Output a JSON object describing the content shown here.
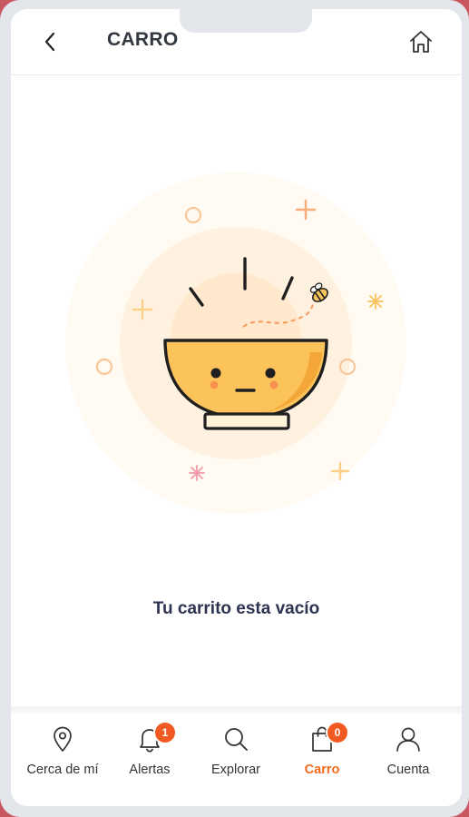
{
  "header": {
    "title": "CARRO",
    "back_icon": "chevron-left-icon",
    "home_icon": "home-icon"
  },
  "main": {
    "empty_message": "Tu carrito esta vacío",
    "illustration": "empty-bowl-with-bee"
  },
  "bottom_nav": {
    "items": [
      {
        "label": "Cerca de mí",
        "icon": "location-pin-icon",
        "active": false
      },
      {
        "label": "Alertas",
        "icon": "bell-icon",
        "badge": "1",
        "active": false
      },
      {
        "label": "Explorar",
        "icon": "search-icon",
        "active": false
      },
      {
        "label": "Carro",
        "icon": "shopping-bag-icon",
        "badge": "0",
        "active": true
      },
      {
        "label": "Cuenta",
        "icon": "user-icon",
        "active": false
      }
    ]
  },
  "colors": {
    "accent": "#f36a1d",
    "badge": "#f05a22",
    "bowl": "#fcc35b",
    "glow": "#fff6ea",
    "text_dark": "#2d3350"
  }
}
